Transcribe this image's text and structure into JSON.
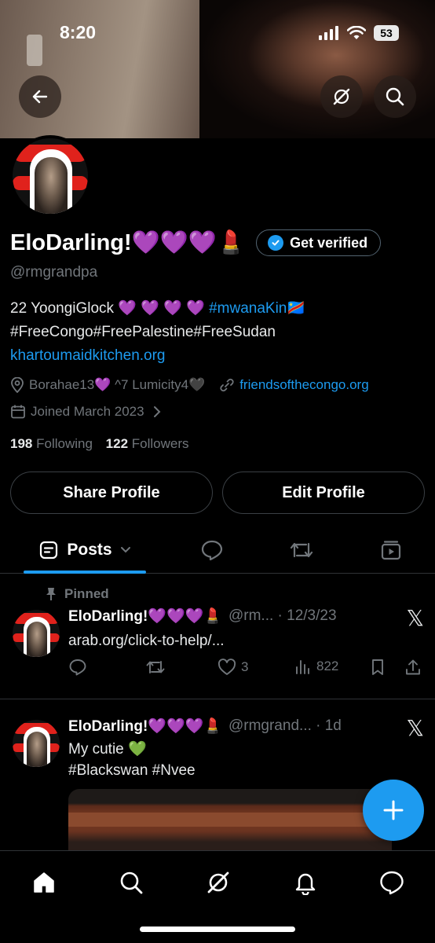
{
  "status_bar": {
    "time": "8:20",
    "battery": "53"
  },
  "profile": {
    "display_name": "EloDarling!💜💜💜💄",
    "get_verified_label": "Get verified",
    "handle": "@rmgrandpa",
    "bio_line1_text": "22 YoongiGlock 💜 💜 💜 💜 ",
    "bio_line1_tag": "#mwanaKin🇨🇩",
    "bio_line2": "#FreeCongo#FreePalestine#FreeSudan",
    "bio_link": "khartoumaidkitchen.org",
    "location": "Borahae13💜 ^7 Lumicity4🖤",
    "website": "friendsofthecongo.org",
    "joined": "Joined March 2023",
    "following_count": "198",
    "following_label": "Following",
    "followers_count": "122",
    "followers_label": "Followers",
    "share_label": "Share Profile",
    "edit_label": "Edit Profile"
  },
  "tabs": {
    "posts_label": "Posts"
  },
  "tweets": [
    {
      "pinned_label": "Pinned",
      "name": "EloDarling!💜💜💜💄",
      "meta": "@rm... · 12/3/23",
      "text": "arab.org/click-to-help/...",
      "likes": "3",
      "views": "822"
    },
    {
      "name": "EloDarling!💜💜💜💄",
      "meta": "@rmgrand... · 1d",
      "text": "My cutie 💚",
      "tags": "#Blackswan #Nvee"
    }
  ],
  "icons": {
    "x_logo": "𝕏",
    "fab_plus": "+"
  },
  "colors": {
    "accent": "#1d9bf0",
    "background": "#000000",
    "muted": "#71767b"
  }
}
